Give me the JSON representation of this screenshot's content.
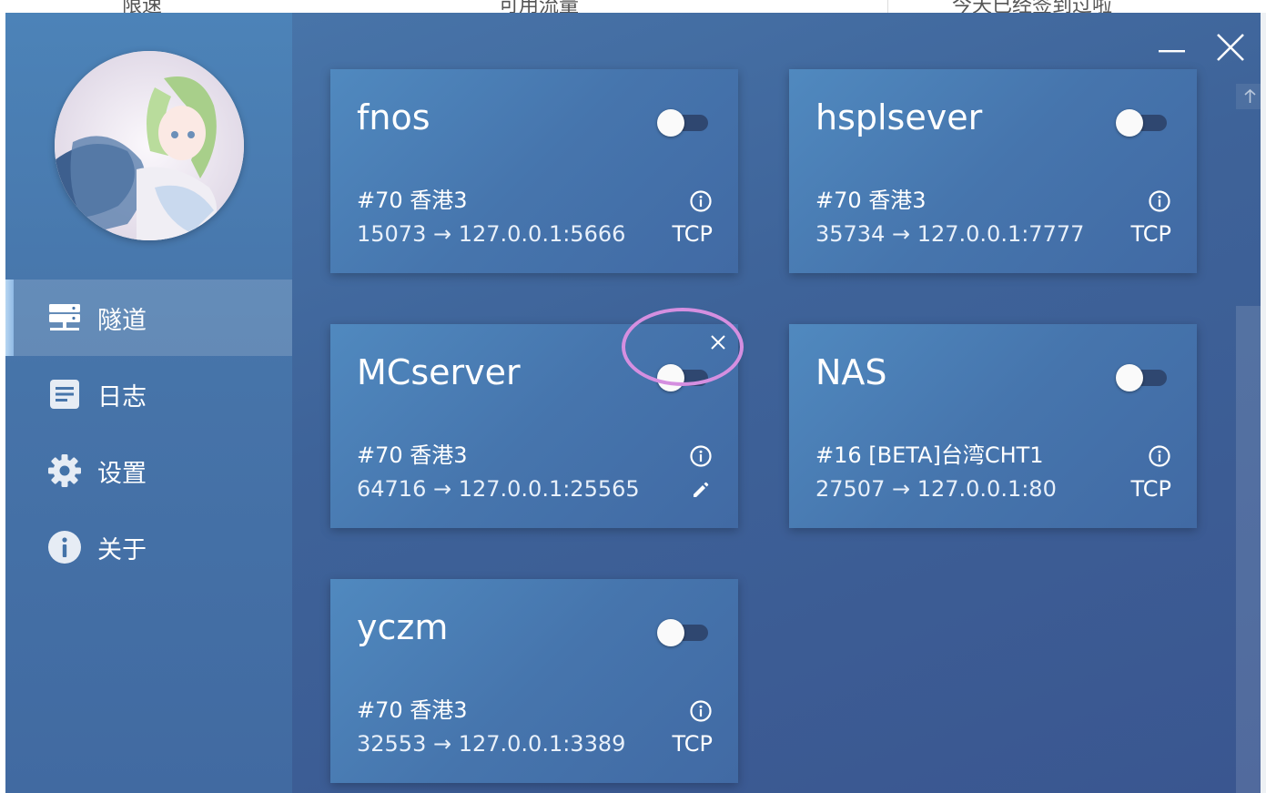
{
  "background": {
    "col1": "限速",
    "col2": "可用流量",
    "col3": "今天已经签到过啦"
  },
  "sidebar": {
    "items": [
      {
        "label": "隧道",
        "icon": "server-icon",
        "active": true
      },
      {
        "label": "日志",
        "icon": "document-icon",
        "active": false
      },
      {
        "label": "设置",
        "icon": "gear-icon",
        "active": false
      },
      {
        "label": "关于",
        "icon": "info-icon",
        "active": false
      }
    ]
  },
  "tunnels": [
    {
      "name": "fnos",
      "node": "#70 香港3",
      "mapping": "15073 → 127.0.0.1:5666",
      "protocol": "TCP",
      "enabled": false
    },
    {
      "name": "hsplsever",
      "node": "#70 香港3",
      "mapping": "35734 → 127.0.0.1:7777",
      "protocol": "TCP",
      "enabled": false
    },
    {
      "name": "MCserver",
      "node": "#70 香港3",
      "mapping": "64716 → 127.0.0.1:25565",
      "protocol": "",
      "enabled": false
    },
    {
      "name": "NAS",
      "node": "#16 [BETA]台湾CHT1",
      "mapping": "27507 → 127.0.0.1:80",
      "protocol": "TCP",
      "enabled": false
    },
    {
      "name": "yczm",
      "node": "#70 香港3",
      "mapping": "32553 → 127.0.0.1:3389",
      "protocol": "TCP",
      "enabled": false
    }
  ],
  "colors": {
    "window_bg": "#3e6399",
    "card_bg": "#4675ad",
    "highlight_ring": "#d58fe0",
    "toggle_track": "#2b3f66"
  }
}
